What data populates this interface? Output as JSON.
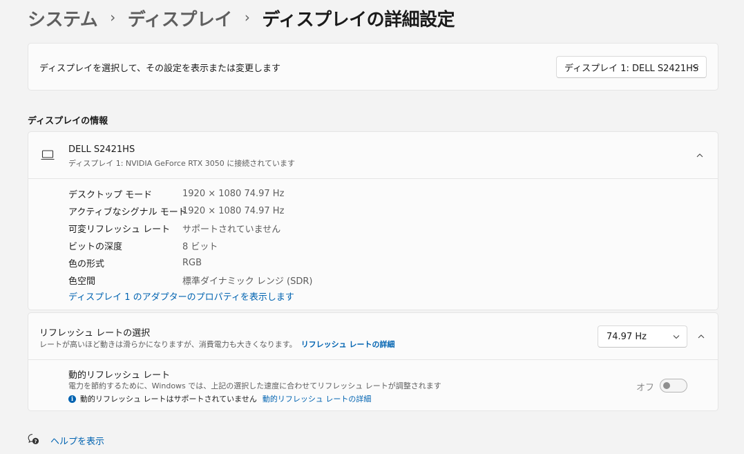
{
  "breadcrumb": {
    "items": [
      "システム",
      "ディスプレイ"
    ],
    "separator": "›",
    "current": "ディスプレイの詳細設定"
  },
  "display_select": {
    "label": "ディスプレイを選択して、その設定を表示または変更します",
    "selected": "ディスプレイ 1: DELL S2421HS"
  },
  "display_info": {
    "section_title": "ディスプレイの情報",
    "monitor_name": "DELL S2421HS",
    "connection": "ディスプレイ 1: NVIDIA GeForce RTX 3050 に接続されています",
    "properties": [
      {
        "key": "デスクトップ モード",
        "value": "1920 × 1080 74.97 Hz"
      },
      {
        "key": "アクティブなシグナル モード",
        "value": "1920 × 1080 74.97 Hz"
      },
      {
        "key": "可変リフレッシュ レート",
        "value": "サポートされていません"
      },
      {
        "key": "ビットの深度",
        "value": "8 ビット"
      },
      {
        "key": "色の形式",
        "value": "RGB"
      },
      {
        "key": "色空間",
        "value": "標準ダイナミック レンジ (SDR)"
      }
    ],
    "adapter_link": "ディスプレイ 1 のアダプターのプロパティを表示します"
  },
  "refresh_rate": {
    "title": "リフレッシュ レートの選択",
    "description": "レートが高いほど動きは滑らかになりますが、消費電力も大きくなります。",
    "details_link": "リフレッシュ レートの詳細",
    "selected": "74.97 Hz"
  },
  "dynamic_refresh": {
    "title": "動的リフレッシュ レート",
    "description": "電力を節約するために、Windows では、上記の選択した速度に合わせてリフレッシュ レートが調整されます",
    "info_text": "動的リフレッシュ レートはサポートされていません",
    "info_link": "動的リフレッシュ レートの詳細",
    "toggle_label": "オフ",
    "toggle_on": false
  },
  "help": {
    "label": "ヘルプを表示"
  },
  "colors": {
    "link": "#0063b1",
    "background": "#f3f3f3",
    "card": "#fbfbfb"
  }
}
